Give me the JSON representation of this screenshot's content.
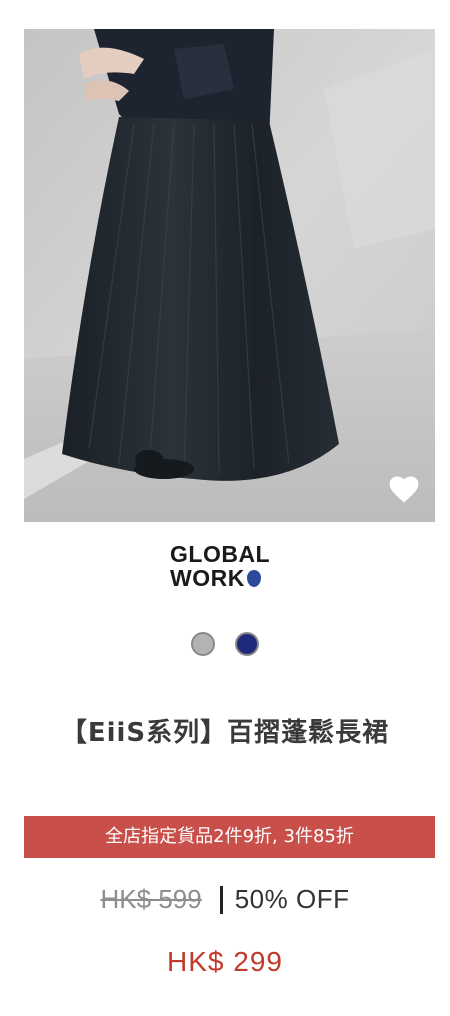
{
  "product": {
    "image_alt": "black pleated long skirt",
    "favorite_icon": "heart-icon",
    "brand": {
      "line1": "GLOBAL",
      "line2": "WORK"
    },
    "swatches": [
      {
        "name": "gray",
        "color": "#b3b3b1"
      },
      {
        "name": "navy",
        "color": "#1f2b7a"
      }
    ],
    "title": "【EiiS系列】百摺蓬鬆長裙",
    "promo": "全店指定貨品2件9折, 3件85折",
    "original_price": "HK$ 599",
    "discount": "50% OFF",
    "sale_price": "HK$ 299"
  },
  "colors": {
    "promo_bg": "#c9504a",
    "sale_price": "#c0392b",
    "logo_dot": "#2c4a9a"
  }
}
